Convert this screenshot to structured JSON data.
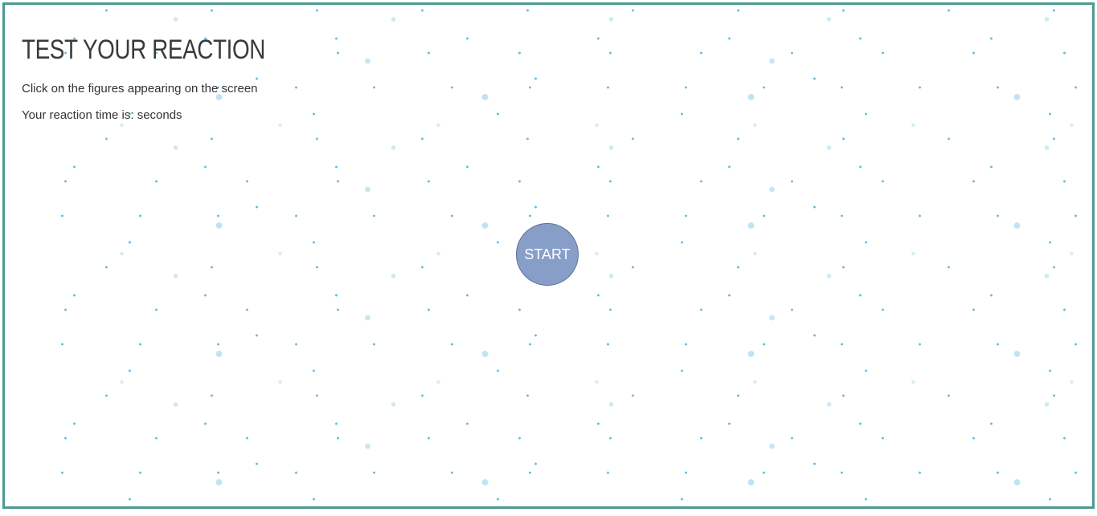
{
  "game": {
    "title": "TEST YOUR REACTION",
    "instruction": "Click on the figures appearing on the screen",
    "reaction_label": "Your reaction time is:",
    "reaction_value": "",
    "reaction_unit": "seconds",
    "start_label": "START"
  },
  "colors": {
    "frame_border": "#4a9a94",
    "start_button_fill": "#879ec9",
    "dot_color": "#62b8e4",
    "text_color": "#333333"
  }
}
